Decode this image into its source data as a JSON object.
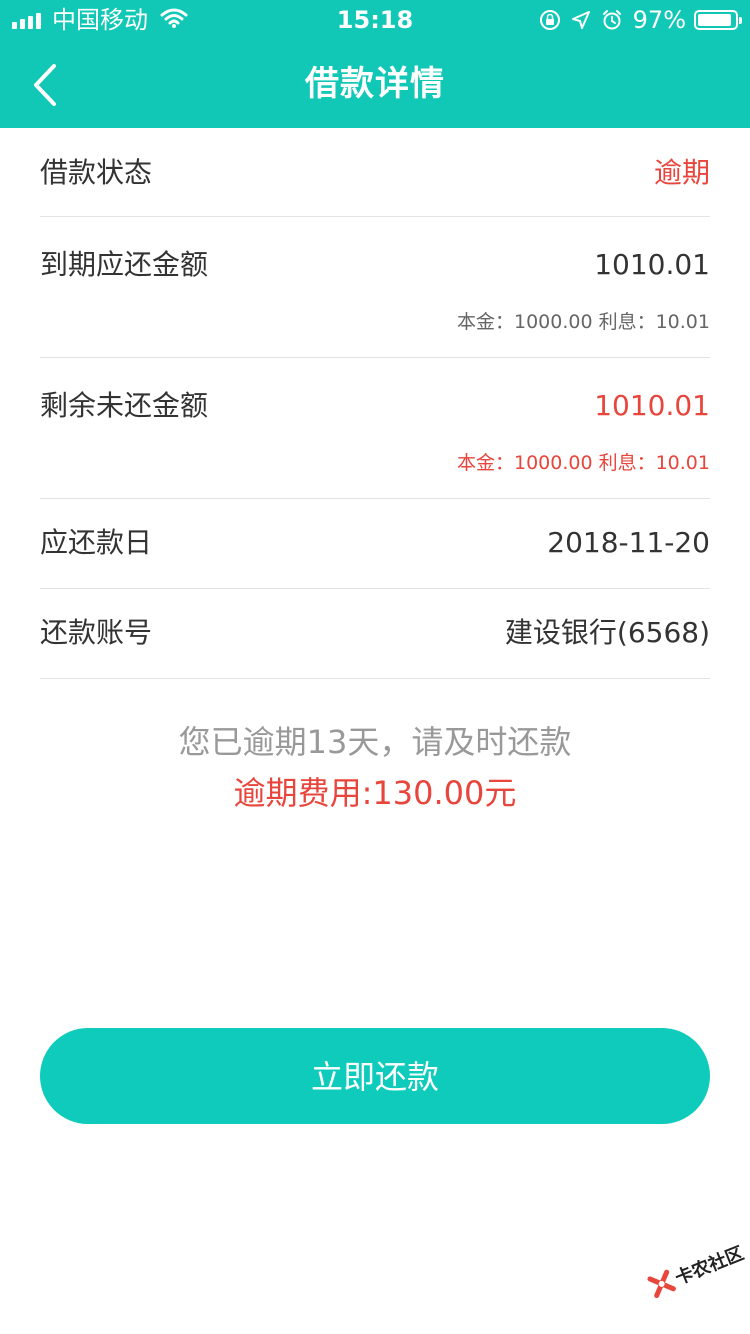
{
  "status_bar": {
    "carrier": "中国移动",
    "time": "15:18",
    "battery": "97%",
    "battery_level": 0.97
  },
  "header": {
    "title": "借款详情",
    "back_icon": "chevron-left-icon"
  },
  "rows": {
    "status": {
      "label": "借款状态",
      "value": "逾期"
    },
    "due_amount": {
      "label": "到期应还金额",
      "value": "1010.01",
      "detail": "本金：1000.00  利息：10.01"
    },
    "remaining": {
      "label": "剩余未还金额",
      "value": "1010.01",
      "detail": "本金：1000.00  利息：10.01"
    },
    "due_date": {
      "label": "应还款日",
      "value": "2018-11-20"
    },
    "account": {
      "label": "还款账号",
      "value": "建设银行(6568)"
    }
  },
  "notice": {
    "line1": "您已逾期13天，请及时还款",
    "line2": "逾期费用:130.00元"
  },
  "pay_button": {
    "label": "立即还款"
  },
  "watermark": {
    "text": "卡农社区"
  },
  "colors": {
    "brand": "#11c8b7",
    "button": "#0fcbbb",
    "alert": "#e8453c",
    "text": "#333333",
    "muted": "#999999"
  }
}
